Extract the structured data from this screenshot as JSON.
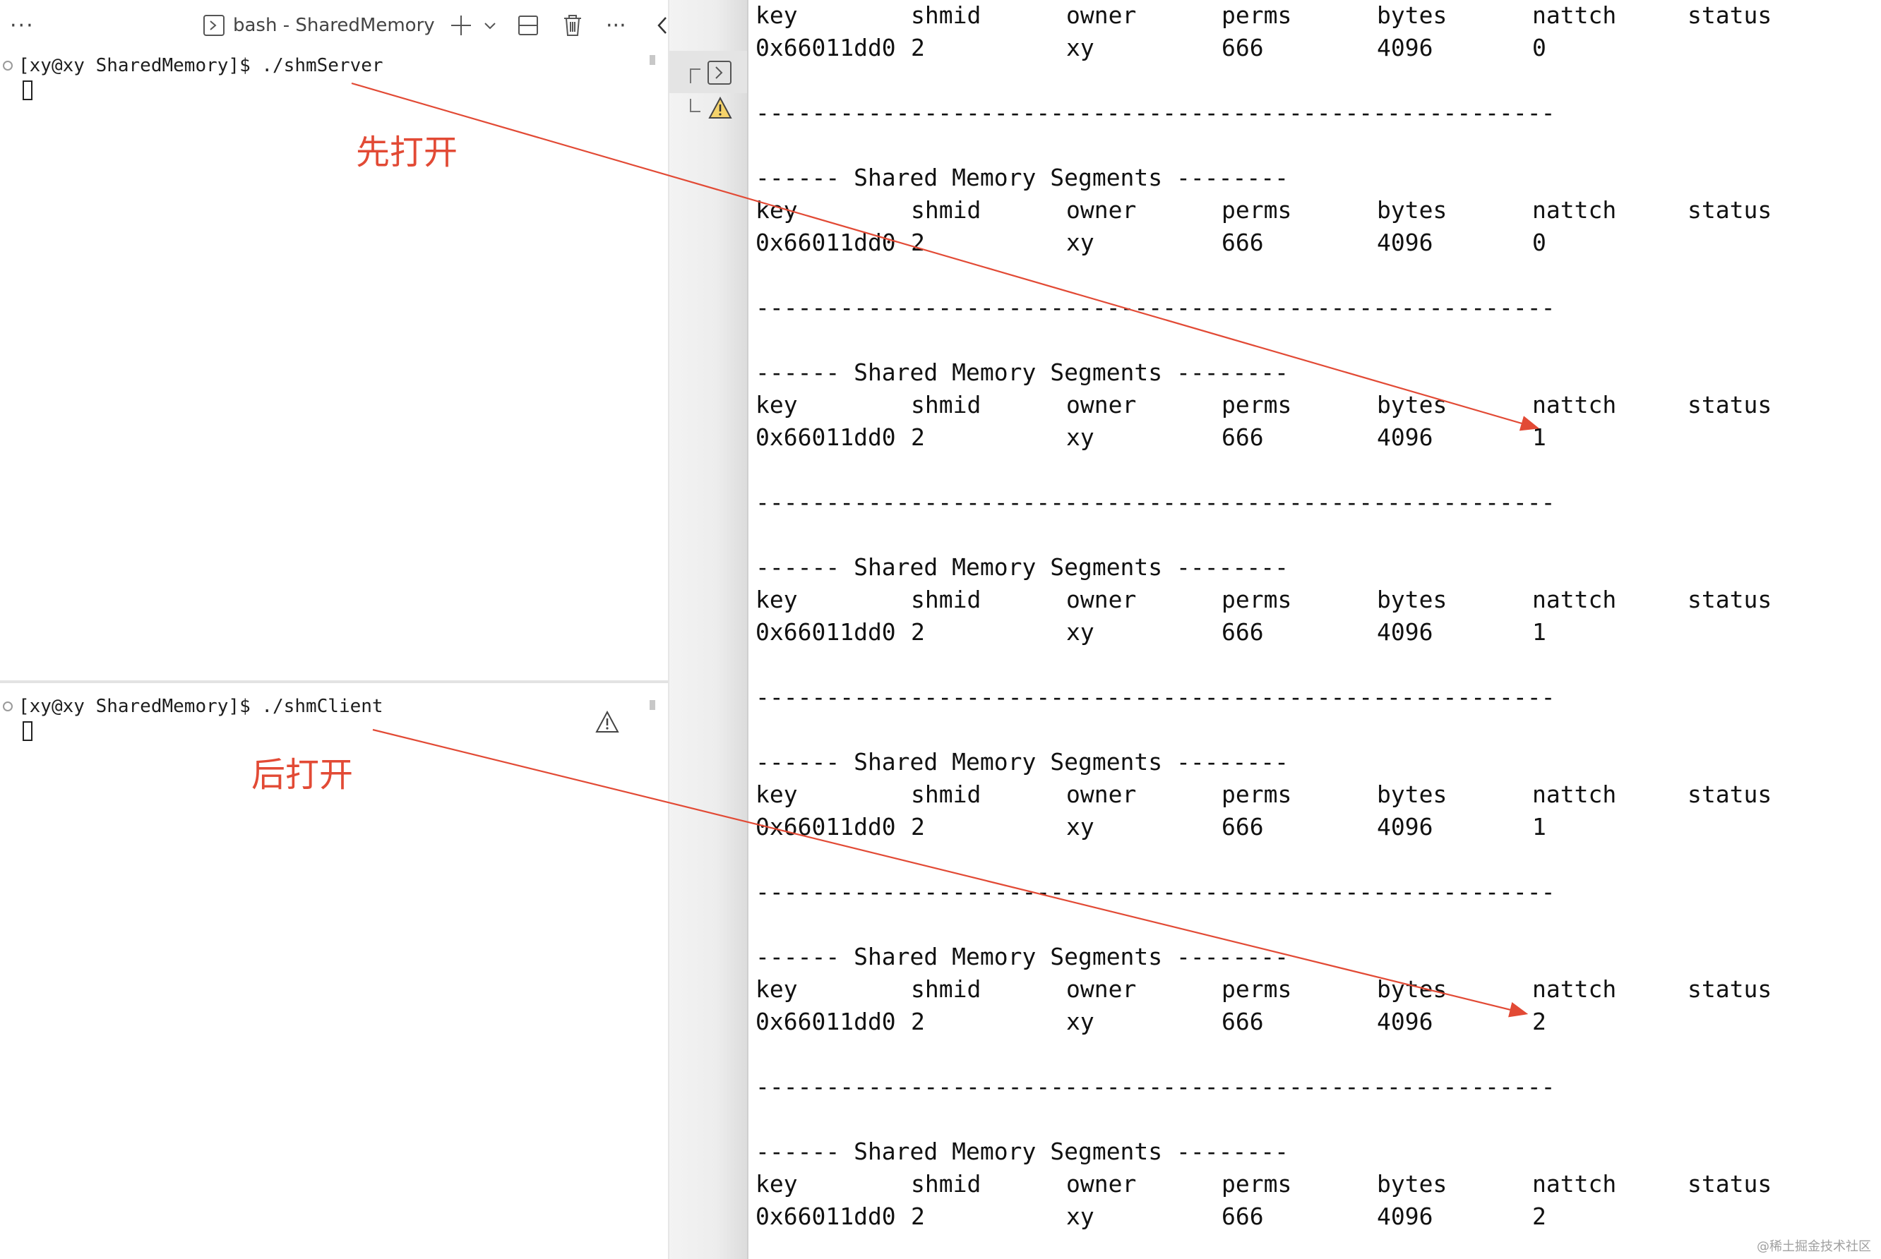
{
  "toolbar": {
    "more_left": "···",
    "tab_title": "bash - SharedMemory",
    "more_right": "···"
  },
  "top_terminal": {
    "prompt": "[xy@xy SharedMemory]$ ./shmServer"
  },
  "bottom_terminal": {
    "prompt": "[xy@xy SharedMemory]$ ./shmClient"
  },
  "annotations": {
    "first_open": "先打开",
    "then_open": "后打开"
  },
  "ipcs_output": {
    "section_title": "------ Shared Memory Segments --------",
    "separator": "---------------------------------------------------------",
    "headers": [
      "key",
      "shmid",
      "owner",
      "perms",
      "bytes",
      "nattch",
      "status"
    ],
    "blocks": [
      {
        "has_title": false,
        "row": [
          "0x66011dd0",
          "2",
          "xy",
          "666",
          "4096",
          "0",
          ""
        ]
      },
      {
        "has_title": true,
        "row": [
          "0x66011dd0",
          "2",
          "xy",
          "666",
          "4096",
          "0",
          ""
        ]
      },
      {
        "has_title": true,
        "row": [
          "0x66011dd0",
          "2",
          "xy",
          "666",
          "4096",
          "1",
          ""
        ]
      },
      {
        "has_title": true,
        "row": [
          "0x66011dd0",
          "2",
          "xy",
          "666",
          "4096",
          "1",
          ""
        ]
      },
      {
        "has_title": true,
        "row": [
          "0x66011dd0",
          "2",
          "xy",
          "666",
          "4096",
          "1",
          ""
        ]
      },
      {
        "has_title": true,
        "row": [
          "0x66011dd0",
          "2",
          "xy",
          "666",
          "4096",
          "2",
          ""
        ]
      },
      {
        "has_title": true,
        "row": [
          "0x66011dd0",
          "2",
          "xy",
          "666",
          "4096",
          "2",
          ""
        ],
        "no_separator": true
      }
    ]
  },
  "watermark": "@稀土掘金技术社区",
  "colors": {
    "annotation": "#e24a35",
    "terminal_text": "#111111",
    "background": "#ffffff"
  }
}
